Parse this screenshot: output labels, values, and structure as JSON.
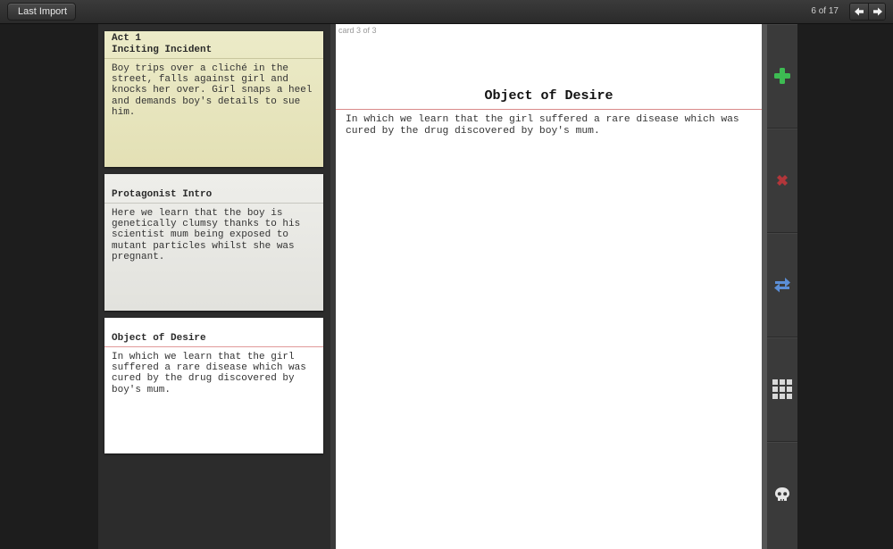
{
  "topbar": {
    "back_label": "Last Import",
    "page_indicator": "6 of 17",
    "prev_icon": "arrow-left-icon",
    "next_icon": "arrow-right-icon"
  },
  "cards": [
    {
      "act": "Act 1",
      "title": "Inciting Incident",
      "body": "Boy trips over a cliché in the street, falls against girl and knocks her over. Girl snaps a heel and demands boy's details to sue him.",
      "color": "#e8e6be"
    },
    {
      "title": "Protagonist Intro",
      "body": "Here we learn that the boy is genetically clumsy thanks to his scientist mum being exposed to mutant particles whilst she was pregnant.",
      "color": "#e9e9e5"
    },
    {
      "title": "Object of Desire",
      "body": "In which we learn that the girl suffered a rare disease which was cured by the drug discovered by boy's mum.",
      "color": "#ffffff"
    }
  ],
  "detail": {
    "meta": "card 3 of 3",
    "title": "Object of Desire",
    "body": "In which we learn that the girl suffered a rare disease which was cured by the drug discovered by boy's mum."
  },
  "toolbar": {
    "tools": [
      "add-icon",
      "delete-icon",
      "swap-icon",
      "grid-icon",
      "skull-icon"
    ],
    "colors": {
      "add": "#3dbb52",
      "delete": "#b2363a",
      "swap": "#5b8ed6",
      "grid": "#d9d9d9",
      "skull": "#e6e6e6"
    }
  }
}
